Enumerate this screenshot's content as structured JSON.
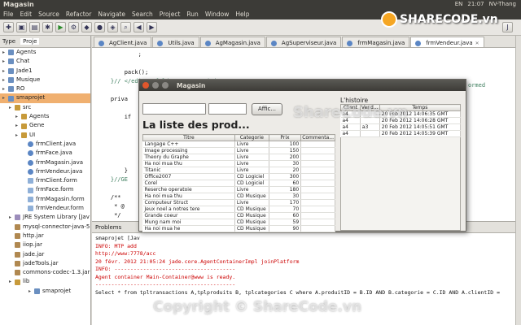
{
  "window": {
    "title": "Magasin",
    "indicators": [
      "EN",
      "21:07",
      "NV-Thang"
    ]
  },
  "menubar": [
    "File",
    "Edit",
    "Source",
    "Refactor",
    "Navigate",
    "Search",
    "Project",
    "Run",
    "Window",
    "Help"
  ],
  "left_panel": {
    "tabs": [
      "Type",
      "Proje"
    ],
    "tree": [
      {
        "label": "Agents",
        "icon": "project-icon",
        "indent": 0
      },
      {
        "label": "Chat",
        "icon": "project-icon",
        "indent": 0
      },
      {
        "label": "Jade1",
        "icon": "project-icon",
        "indent": 0
      },
      {
        "label": "Musique",
        "icon": "project-icon",
        "indent": 0
      },
      {
        "label": "RO",
        "icon": "project-icon",
        "indent": 0
      },
      {
        "label": "smaprojet",
        "icon": "project-icon",
        "indent": 0
      },
      {
        "label": "src",
        "icon": "source-folder-icon",
        "indent": 1
      },
      {
        "label": "Agents",
        "icon": "package-icon",
        "indent": 2
      },
      {
        "label": "Gene",
        "icon": "package-icon",
        "indent": 2
      },
      {
        "label": "UI",
        "icon": "package-icon",
        "indent": 2
      },
      {
        "label": "frmClient.java",
        "icon": "java-file-icon",
        "indent": 3
      },
      {
        "label": "frmFace.java",
        "icon": "java-file-icon",
        "indent": 3
      },
      {
        "label": "frmMagasin.java",
        "icon": "java-file-icon",
        "indent": 3
      },
      {
        "label": "frmVendeur.java",
        "icon": "java-file-icon",
        "indent": 3
      },
      {
        "label": "frmClient.form",
        "icon": "form-file-icon",
        "indent": 3
      },
      {
        "label": "frmFace.form",
        "icon": "form-file-icon",
        "indent": 3
      },
      {
        "label": "frmMagasin.form",
        "icon": "form-file-icon",
        "indent": 3
      },
      {
        "label": "frmVendeur.form",
        "icon": "form-file-icon",
        "indent": 3
      },
      {
        "label": "JRE System Library [Jav",
        "icon": "library-icon",
        "indent": 1
      },
      {
        "label": "mysql-connector-java-5.",
        "icon": "jar-icon",
        "indent": 1
      },
      {
        "label": "http.jar",
        "icon": "jar-icon",
        "indent": 1
      },
      {
        "label": "iiop.jar",
        "icon": "jar-icon",
        "indent": 1
      },
      {
        "label": "jade.jar",
        "icon": "jar-icon",
        "indent": 1
      },
      {
        "label": "jadeTools.jar",
        "icon": "jar-icon",
        "indent": 1
      },
      {
        "label": "commons-codec-1.3.jar",
        "icon": "jar-icon",
        "indent": 1
      },
      {
        "label": "lib",
        "icon": "folder-icon",
        "indent": 1
      },
      {
        "label": "smaprojet",
        "icon": "project-icon",
        "indent": 4
      }
    ]
  },
  "editor": {
    "tabs": [
      "AgClient.java",
      "Utils.java",
      "AgMagasin.java",
      "AgSuperviseur.java",
      "frmMagasin.java",
      "frmVendeur.java"
    ],
    "active_tab": 5,
    "code_lines": [
      {
        "text": "            ;"
      },
      {
        "text": ""
      },
      {
        "text": "        pack();"
      },
      {
        "text": "    }// </editor-fold>//GEN-END:initComponents"
      },
      {
        "text": ""
      },
      {
        "text": "    priva"
      },
      {
        "text": ""
      },
      {
        "text": "        if"
      },
      {
        "text": ""
      },
      {
        "text": ""
      },
      {
        "text": ""
      },
      {
        "text": ""
      },
      {
        "text": ""
      },
      {
        "text": "        }"
      },
      {
        "text": "    }//GE"
      },
      {
        "text": ""
      },
      {
        "text": "    /**"
      },
      {
        "text": "     * @"
      },
      {
        "text": "     */"
      },
      {
        "text": "    publi"
      }
    ],
    "right_fragment": "ormed"
  },
  "console": {
    "tabs": [
      "Problems",
      "smaprojet"
    ],
    "lines": [
      {
        "text": "smaprojet [Jav",
        "kind": "blk"
      },
      {
        "text": "INFO: MTP add",
        "kind": "red"
      },
      {
        "text": "http://www:7778/acc",
        "kind": "red"
      },
      {
        "text": "20 févr. 2012 21:05:24 jade.core.AgentContainerImpl joinPlatform",
        "kind": "red"
      },
      {
        "text": "INFO: --------------------------------------",
        "kind": "red"
      },
      {
        "text": "Agent container Main-Container@www is ready.",
        "kind": "red"
      },
      {
        "text": "--------------------------------------------",
        "kind": "red"
      },
      {
        "text": "Select * from tpltransactions A,tplproduits B, tplcategories C where A.produitID = B.ID AND B.categorie = C.ID AND A.clientID =",
        "kind": "blk"
      }
    ]
  },
  "dialog": {
    "title": "Magasin",
    "button_label": "Affic...",
    "heading": "La liste des prod...",
    "product_columns": [
      "Titre",
      "Categorie",
      "Prix",
      "Commenta..."
    ],
    "products": [
      [
        "Langage C++",
        "Livre",
        "100",
        ""
      ],
      [
        "Image processing",
        "Livre",
        "150",
        ""
      ],
      [
        "Theory du Graphe",
        "Livre",
        "200",
        ""
      ],
      [
        "Ha noi mua thu",
        "Livre",
        "30",
        ""
      ],
      [
        "Titanic",
        "Livre",
        "20",
        ""
      ],
      [
        "Office2007",
        "CD Logiciel",
        "300",
        ""
      ],
      [
        "Corel",
        "CD Logiciel",
        "60",
        ""
      ],
      [
        "Reserche operatoie",
        "Livre",
        "180",
        ""
      ],
      [
        "Ha noi mua thu",
        "CD Musique",
        "30",
        ""
      ],
      [
        "Computeur Struct",
        "Livre",
        "170",
        ""
      ],
      [
        "Jeux noel a notres tere",
        "CD Musique",
        "70",
        ""
      ],
      [
        "Grande coeur",
        "CD Musique",
        "60",
        ""
      ],
      [
        "Mung nam moi",
        "CD Musique",
        "59",
        ""
      ],
      [
        "Ha noi mua  he",
        "CD Musique",
        "90",
        ""
      ]
    ],
    "history_label": "L'histoire",
    "history_columns": [
      "Client",
      "Vend...",
      "Temps"
    ],
    "history": [
      [
        "a4",
        "",
        "20 Feb 2012 14:06:35 GMT"
      ],
      [
        "a4",
        "",
        "20 Feb 2012 14:06:28 GMT"
      ],
      [
        "a4",
        "a3",
        "20 Feb 2012 14:05:51 GMT"
      ],
      [
        "a4",
        "",
        "20 Feb 2012 14:05:39 GMT"
      ]
    ]
  },
  "watermarks": {
    "logo": "SHARECODE.vn",
    "center": "ShareCode.vn",
    "bottom": "Copyright © ShareCode.vn"
  }
}
